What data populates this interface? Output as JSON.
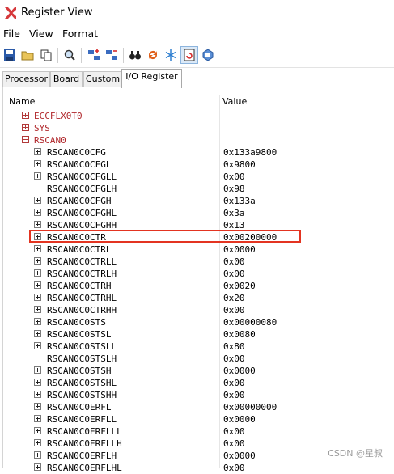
{
  "window": {
    "title": "Register View"
  },
  "menu": [
    "File",
    "View",
    "Format"
  ],
  "toolbar": {
    "buttons": [
      "save-icon",
      "open-folder-icon",
      "copy-icon",
      "find-icon",
      "add-register-icon",
      "remove-register-icon",
      "binoculars-icon",
      "refresh-icon",
      "snowflake-icon",
      "realtime-icon",
      "options-icon"
    ]
  },
  "tabs": [
    "Processor",
    "Board",
    "Custom",
    "I/O Register"
  ],
  "active_tab": "I/O Register",
  "columns": {
    "name": "Name",
    "value": "Value"
  },
  "tree": {
    "groups": [
      "ECCFLX0T0",
      "SYS",
      "RSCAN0"
    ],
    "rows": [
      {
        "name": "RSCAN0C0CFG",
        "value": "0x133a9800"
      },
      {
        "name": "RSCAN0C0CFGL",
        "value": "0x9800"
      },
      {
        "name": "RSCAN0C0CFGLL",
        "value": "0x00"
      },
      {
        "name": "RSCAN0C0CFGLH",
        "value": "0x98"
      },
      {
        "name": "RSCAN0C0CFGH",
        "value": "0x133a"
      },
      {
        "name": "RSCAN0C0CFGHL",
        "value": "0x3a"
      },
      {
        "name": "RSCAN0C0CFGHH",
        "value": "0x13"
      },
      {
        "name": "RSCAN0C0CTR",
        "value": "0x00200000"
      },
      {
        "name": "RSCAN0C0CTRL",
        "value": "0x0000"
      },
      {
        "name": "RSCAN0C0CTRLL",
        "value": "0x00"
      },
      {
        "name": "RSCAN0C0CTRLH",
        "value": "0x00"
      },
      {
        "name": "RSCAN0C0CTRH",
        "value": "0x0020"
      },
      {
        "name": "RSCAN0C0CTRHL",
        "value": "0x20"
      },
      {
        "name": "RSCAN0C0CTRHH",
        "value": "0x00"
      },
      {
        "name": "RSCAN0C0STS",
        "value": "0x00000080"
      },
      {
        "name": "RSCAN0C0STSL",
        "value": "0x0080"
      },
      {
        "name": "RSCAN0C0STSLL",
        "value": "0x80"
      },
      {
        "name": "RSCAN0C0STSLH",
        "value": "0x00"
      },
      {
        "name": "RSCAN0C0STSH",
        "value": "0x0000"
      },
      {
        "name": "RSCAN0C0STSHL",
        "value": "0x00"
      },
      {
        "name": "RSCAN0C0STSHH",
        "value": "0x00"
      },
      {
        "name": "RSCAN0C0ERFL",
        "value": "0x00000000"
      },
      {
        "name": "RSCAN0C0ERFLL",
        "value": "0x0000"
      },
      {
        "name": "RSCAN0C0ERFLLL",
        "value": "0x00"
      },
      {
        "name": "RSCAN0C0ERFLLH",
        "value": "0x00"
      },
      {
        "name": "RSCAN0C0ERFLH",
        "value": "0x0000"
      },
      {
        "name": "RSCAN0C0ERFLHL",
        "value": "0x00"
      }
    ],
    "highlighted_row": "RSCAN0C0CTR"
  },
  "watermark": "CSDN @星叔",
  "colors": {
    "highlight": "#e33421",
    "group_text": "#b0272b"
  }
}
